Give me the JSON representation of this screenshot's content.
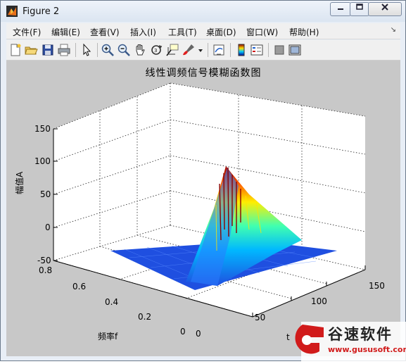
{
  "window": {
    "title": "Figure 2"
  },
  "menu": [
    "文件(F)",
    "编辑(E)",
    "查看(V)",
    "插入(I)",
    "工具(T)",
    "桌面(D)",
    "窗口(W)",
    "帮助(H)"
  ],
  "toolbar_icons": [
    "new-figure-icon",
    "open-file-icon",
    "save-icon",
    "print-icon",
    "pointer-icon",
    "zoom-in-icon",
    "zoom-out-icon",
    "pan-icon",
    "rotate-3d-icon",
    "data-cursor-icon",
    "brush-icon",
    "link-plot-icon",
    "colorbar-icon",
    "legend-icon",
    "hide-plot-tools-icon",
    "show-plot-tools-icon"
  ],
  "plot": {
    "title": "线性调频信号模糊函数图",
    "zlabel": "幅值A",
    "ylabel": "频率f",
    "xlabel": "t",
    "z_ticks": [
      "150",
      "100",
      "50",
      "0",
      "-50"
    ],
    "y_ticks": [
      "0.8",
      "0.6",
      "0.4",
      "0.2",
      "0"
    ],
    "x_ticks": [
      "0",
      "50",
      "100",
      "150"
    ],
    "colormap": "jet",
    "surface_color": "#1f4fe0"
  },
  "watermark": {
    "brand": "谷速软件",
    "url": "www.gususoft.com"
  }
}
